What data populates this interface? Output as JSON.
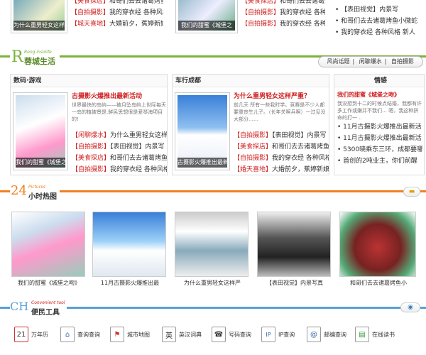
{
  "top_strip": {
    "caption_left": "为什么重男轻女这样",
    "lines_left": [
      "【美食探店】和哥们去去诸葛烤鱼小",
      "【自拍摄影】我的穿衣经 各种风格 新",
      "【城天喜地】大婚前夕，蕉婷新娘发"
    ],
    "caption_mid": "我们的甜蜜《城堡之",
    "lines_mid": [
      "【美食探店】和哥们去去诸葛烤鱼小",
      "【自拍摄影】我的穿衣经 各种风格",
      "【自拍摄影】我的穿衣经 各种风格"
    ],
    "lines_right": [
      "【表田视觉】内景写",
      "和哥们去去诸葛烤鱼小微蛇",
      "我的穿衣经 各种风格 新人"
    ]
  },
  "sec1": {
    "logo_letter": "R",
    "logo_en": "Rong insolife",
    "logo_cn": "蓉城生活",
    "tabs": [
      "风尚话题",
      "闲聊爆水",
      "自拍摄影"
    ]
  },
  "col1": {
    "title": "数码·游戏",
    "headline": "古摄影火爆推出最新活动",
    "summary": "世界最快的岛屿——被月坠岛屿上世际每天一岛的植被景是.鲜民思想很是爱琴海项目的!",
    "lines": [
      "【闲聊爆水】为什么重男轻女这样严",
      "【自拍摄影】【表田视觉】内景写",
      "【美食探店】和哥们去去诸葛烤鱼小",
      "【自拍摄影】我的穿衣经 各种风格"
    ],
    "caption": "我们的甜蜜《城堡之"
  },
  "col2": {
    "title": "车行成都",
    "headline": "为什么重男轻女这样严重？",
    "summary": "前几天 所有一些我时学。竞赛是不少人都要重丧生儿子。（长年关啊兵啊）一过见没大部分……",
    "lines": [
      "【自拍摄影】【表田视觉】内景写",
      "【美食探店】和哥们去去诸葛烤鱼小",
      "【自拍摄影】我的穿衣经 各种风格 新",
      "【婚天喜地】大婚前夕，蕉婷新娘发"
    ],
    "caption": "古摄影火爆推出最新"
  },
  "col3": {
    "title": "情感",
    "headline": "我们的甜蜜《城堡之吻》",
    "summary": "我没想到十二的时候点结婚，我都有许多工作或嫌并不我们… 嗯，我这种拼命的打一 ..",
    "lines": [
      "11月古摄影火爆推出最新活",
      "11月古摄影火爆推出最新活",
      "5300晓乘东三环，成都要哪",
      "首创的2吨业主，你们前醒"
    ]
  },
  "sec2": {
    "logo_num": "24",
    "logo_en": "Pictures",
    "logo_cn": "小时热图"
  },
  "gallery": [
    "我们的甜蜜《城堡之吻》",
    "11月古摄影火爆推出最",
    "为什么重男轻女这样严",
    "【表田视觉】内景写真",
    "和哥们去去诸葛烤鱼小"
  ],
  "sec3": {
    "logo_letter": "CH",
    "logo_en": "Convenient tool",
    "logo_cn": "便民工具"
  },
  "tools": [
    {
      "icon": "calendar-icon",
      "glyph": "21",
      "label": "万年历"
    },
    {
      "icon": "house-icon",
      "glyph": "⌂",
      "label": "查询查询"
    },
    {
      "icon": "map-icon",
      "glyph": "⚑",
      "label": "城市地图"
    },
    {
      "icon": "dictionary-icon",
      "glyph": "英",
      "label": "英汉词典"
    },
    {
      "icon": "phone-icon",
      "glyph": "☎",
      "label": "号码查询"
    },
    {
      "icon": "ip-icon",
      "glyph": "IP",
      "label": "IP查询"
    },
    {
      "icon": "postcode-icon",
      "glyph": "@",
      "label": "邮编查询"
    },
    {
      "icon": "books-icon",
      "glyph": "▤",
      "label": "在线读书"
    }
  ],
  "colors": {
    "accent_green": "#7bb23a",
    "accent_orange": "#f08020",
    "accent_blue": "#5aa0d8",
    "tag_red": "#d02020"
  }
}
